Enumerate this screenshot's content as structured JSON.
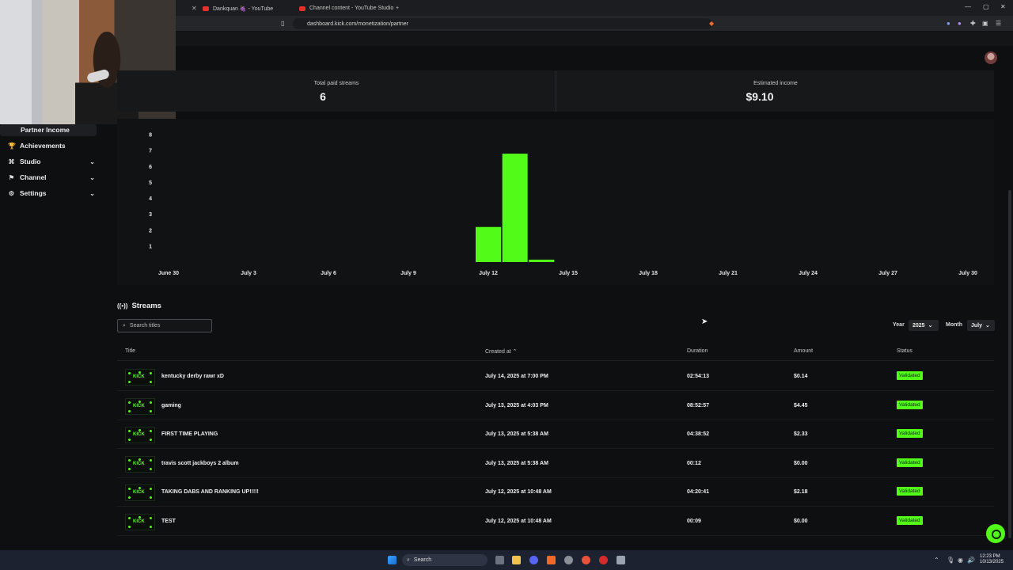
{
  "browser": {
    "tabs": [
      {
        "label": "Dankquan 🍇 - YouTube"
      },
      {
        "label": "Channel content - YouTube Studio"
      }
    ],
    "url": "dashboard.kick.com/monetization/partner"
  },
  "sidebar": {
    "items": [
      {
        "label": "Partner Income",
        "icon": "coin-icon",
        "active": true
      },
      {
        "label": "Achievements",
        "icon": "trophy-icon"
      },
      {
        "label": "Studio",
        "icon": "studio-icon",
        "expandable": true
      },
      {
        "label": "Channel",
        "icon": "channel-icon",
        "expandable": true
      },
      {
        "label": "Settings",
        "icon": "gear-icon",
        "expandable": true
      }
    ]
  },
  "stats": {
    "total_paid_streams_label": "Total paid streams",
    "total_paid_streams_value": "6",
    "estimated_income_label": "Estimated income",
    "estimated_income_value": "$9.10"
  },
  "chart_data": {
    "type": "bar",
    "title": "",
    "xlabel": "",
    "ylabel": "",
    "x_tick_labels": [
      "June 30",
      "July 3",
      "July 6",
      "July 9",
      "July 12",
      "July 15",
      "July 18",
      "July 21",
      "July 24",
      "July 27",
      "July 30"
    ],
    "y_tick_labels": [
      "1",
      "2",
      "3",
      "4",
      "5",
      "6",
      "7",
      "8"
    ],
    "ylim": [
      0,
      8
    ],
    "categories": [
      "July 12",
      "July 13",
      "July 14"
    ],
    "values": [
      2.2,
      6.8,
      0.15
    ],
    "color": "#53fc18"
  },
  "streams": {
    "heading": "Streams",
    "search_placeholder": "Search titles",
    "filters": {
      "year_label": "Year",
      "year_value": "2025",
      "month_label": "Month",
      "month_value": "July"
    },
    "columns": [
      "Title",
      "Created at",
      "Duration",
      "Amount",
      "Status"
    ],
    "rows": [
      {
        "title": "kentucky derby rawr xD",
        "created": "July 14, 2025 at 7:00 PM",
        "duration": "02:54:13",
        "amount": "$0.14",
        "status": "Validated"
      },
      {
        "title": "gaming",
        "created": "July 13, 2025 at 4:03 PM",
        "duration": "08:52:57",
        "amount": "$4.45",
        "status": "Validated"
      },
      {
        "title": "FIRST TIME PLAYING",
        "created": "July 13, 2025 at 5:38 AM",
        "duration": "04:38:52",
        "amount": "$2.33",
        "status": "Validated"
      },
      {
        "title": "travis scott jackboys 2 album",
        "created": "July 13, 2025 at 5:38 AM",
        "duration": "00:12",
        "amount": "$0.00",
        "status": "Validated"
      },
      {
        "title": "TAKING DABS AND RANKING UP!!!!!",
        "created": "July 12, 2025 at 10:48 AM",
        "duration": "04:20:41",
        "amount": "$2.18",
        "status": "Validated"
      },
      {
        "title": "TEST",
        "created": "July 12, 2025 at 10:48 AM",
        "duration": "00:09",
        "amount": "$0.00",
        "status": "Validated"
      }
    ],
    "thumb_text": "KICK"
  },
  "taskbar": {
    "search_label": "Search",
    "time": "12:23 PM",
    "date": "10/13/2025"
  }
}
